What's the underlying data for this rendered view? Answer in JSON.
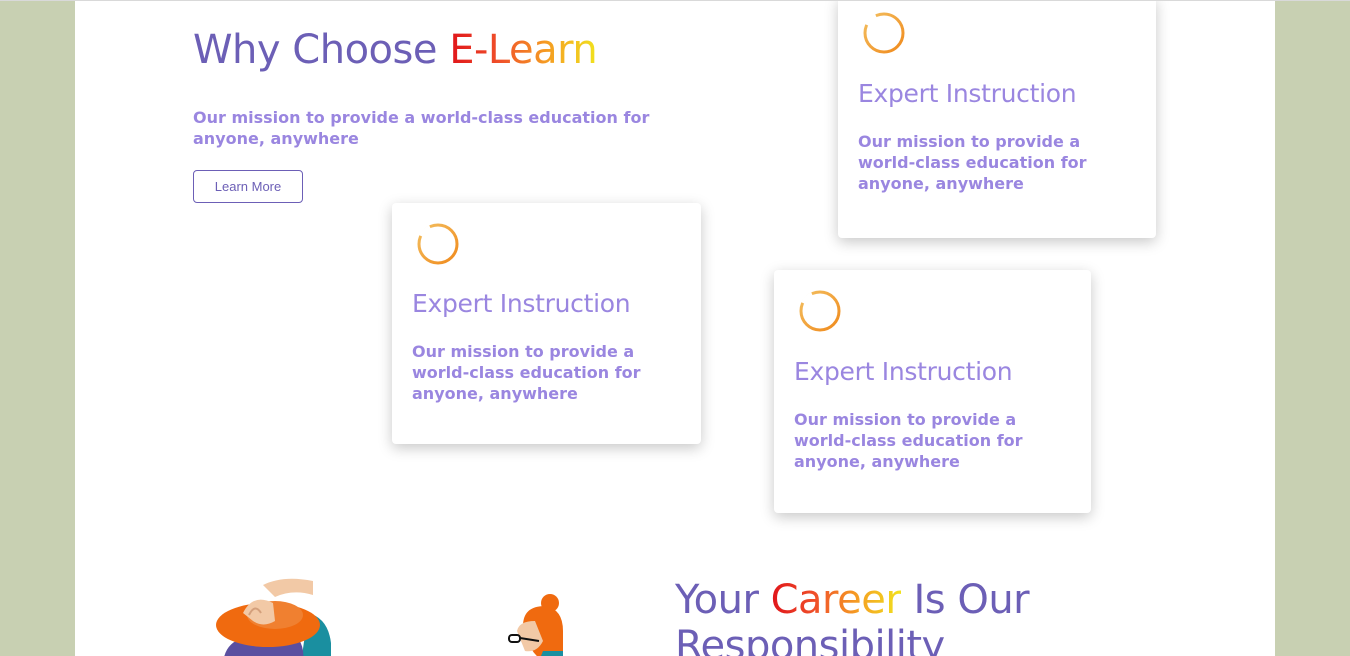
{
  "hero": {
    "title_plain": "Why Choose ",
    "title_highlight": "E-Learn",
    "mission": "Our mission to provide a world-class education for anyone, anywhere",
    "button_label": "Learn More"
  },
  "cards": [
    {
      "title": "Expert Instruction",
      "text": "Our mission to provide a world-class education for anyone, anywhere",
      "icon": "ring-icon"
    },
    {
      "title": "Expert Instruction",
      "text": "Our mission to provide a world-class education for anyone, anywhere",
      "icon": "ring-icon"
    },
    {
      "title": "Expert Instruction",
      "text": "Our mission to provide a world-class education for anyone, anywhere",
      "icon": "ring-icon"
    }
  ],
  "career": {
    "title_plain_1": "Your ",
    "title_highlight": "Career",
    "title_plain_2": " Is Our Responsibility"
  },
  "colors": {
    "page_bg": "#c8d0b2",
    "heading": "#6c5fb6",
    "body_text": "#9a86e0",
    "gradient": [
      "#e0141a",
      "#f0522a",
      "#f59a23",
      "#f1e21e"
    ],
    "ring": "#f5a233"
  }
}
